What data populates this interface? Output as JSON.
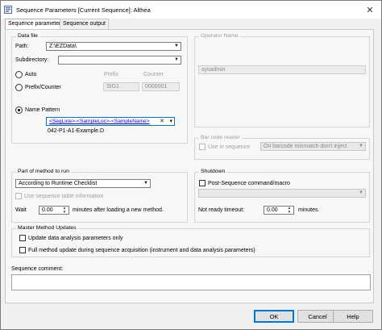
{
  "window": {
    "title": "Sequence Parameters [Current Sequence]: Althea",
    "close_glyph": "✕"
  },
  "tabs": [
    "Sequence parameters",
    "Sequence output"
  ],
  "data_file": {
    "group_title": "Data file",
    "path_label": "Path:",
    "path_value": "Z:\\EZData\\",
    "subdirectory_label": "Subdirectory:",
    "subdirectory_value": "",
    "auto_label": "Auto",
    "prefix_header": "Prefix",
    "counter_header": "Counter",
    "prefix_counter_label": "Prefix/Counter",
    "prefix_value": "SIG1",
    "counter_value": "0000001",
    "name_pattern_label": "Name Pattern",
    "name_pattern_value": "<SeqLine>-<SampleLoc>-<SampleName>",
    "pattern_x_glyph": "✕",
    "pattern_arrow_glyph": "▾",
    "example": "042-P1-A1-Example.D",
    "selected_mode": "name_pattern"
  },
  "operator": {
    "group_title": "Operator Name",
    "value": "sysadmin"
  },
  "barcode": {
    "group_title": "Bar code reader",
    "use_label": "Use in sequence",
    "mismatch_value": "On barcode mismatch don't inject"
  },
  "part_of_method": {
    "group_title": "Part of method to run",
    "value": "According to Runtime Checklist",
    "use_table_label": "Use sequence table information",
    "wait_label": "Wait",
    "wait_value": "0.00",
    "wait_suffix": "minutes after loading a new method."
  },
  "shutdown": {
    "group_title": "Shutdown",
    "post_label": "Post-Sequence command/macro",
    "command_value": "",
    "not_ready_label": "Not ready timeout:",
    "not_ready_value": "0.00",
    "not_ready_suffix": "minutes."
  },
  "master_method": {
    "group_title": "Master Method Updates",
    "opt1": "Update data analysis parameters only",
    "opt2": "Full method update during sequence acquisition (instrument and data analysis parameters)"
  },
  "sequence_comment_label": "Sequence comment:",
  "sequence_comment_value": "",
  "buttons": {
    "ok": "OK",
    "cancel": "Cancel",
    "help": "Help"
  },
  "icons": {
    "app": "app-icon",
    "dropdown": "chevron-down-icon",
    "spin": "spin-arrows-icon"
  },
  "colors": {
    "accent": "#0078d7",
    "link": "#0000ee",
    "disabled_text": "#a0a0a0"
  }
}
